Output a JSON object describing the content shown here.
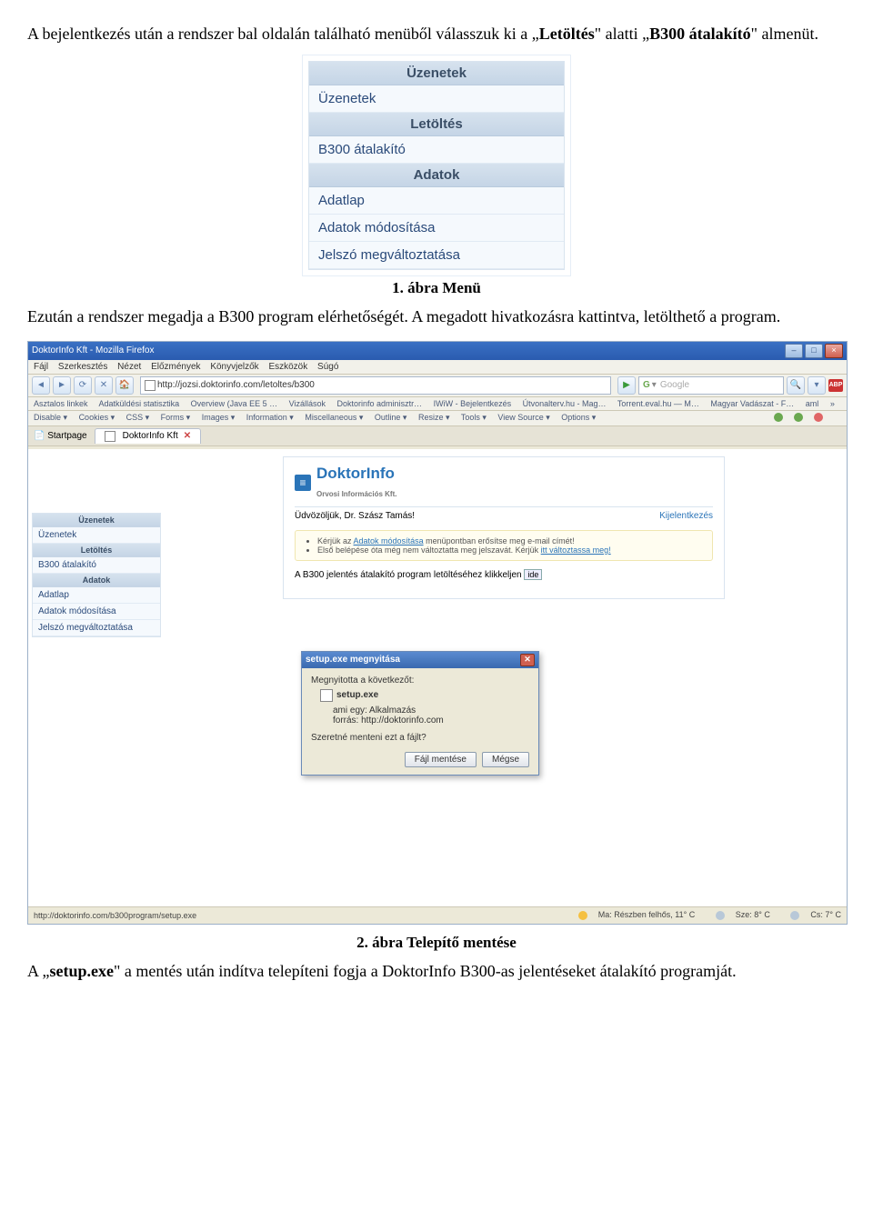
{
  "para1_a": "A bejelentkezés után a rendszer bal oldalán található menüből válasszuk ki a „",
  "para1_b": "Letöltés",
  "para1_c": "\" alatti „",
  "para1_d": "B300 átalakító",
  "para1_e": "\" almenüt.",
  "menu": {
    "h1": "Üzenetek",
    "i1": "Üzenetek",
    "h2": "Letöltés",
    "i2": "B300 átalakító",
    "h3": "Adatok",
    "i3": "Adatlap",
    "i4": "Adatok módosítása",
    "i5": "Jelszó megváltoztatása"
  },
  "caption1": "1. ábra Menü",
  "para2": "Ezután a rendszer megadja a B300 program elérhetőségét. A megadott hivatkozásra kattintva, letölthető a program.",
  "browser": {
    "title": "DoktorInfo Kft - Mozilla Firefox",
    "min": "‒",
    "max": "□",
    "close": "×",
    "ffmenu": {
      "m1": "Fájl",
      "m2": "Szerkesztés",
      "m3": "Nézet",
      "m4": "Előzmények",
      "m5": "Könyvjelzők",
      "m6": "Eszközök",
      "m7": "Súgó"
    },
    "nav": {
      "back": "◄",
      "fwd": "►",
      "reload": "⟳",
      "stop": "✕",
      "home": "🏠",
      "url": "http://jozsi.doktorinfo.com/letoltes/b300",
      "go": "▶",
      "search_placeholder": "Google",
      "search_icon": "G",
      "mag": "🔍",
      "down": "▾",
      "abp": "ABP"
    },
    "bookmarks": {
      "b1": "Asztalos linkek",
      "b2": "Adatküldési statisztika",
      "b3": "Overview (Java EE 5 …",
      "b4": "Vizállások",
      "b5": "Doktorinfo adminisztr…",
      "b6": "IWiW - Bejelentkezés",
      "b7": "Útvonalterv.hu - Mag…",
      "b8": "Torrent.eval.hu — M…",
      "b9": "Magyar Vadászat - F…",
      "b10": "aml",
      "more": "»"
    },
    "devbar": {
      "d1": "Disable ▾",
      "d2": "Cookies ▾",
      "d3": "CSS ▾",
      "d4": "Forms ▾",
      "d5": "Images ▾",
      "d6": "Information ▾",
      "d7": "Miscellaneous ▾",
      "d8": "Outline ▾",
      "d9": "Resize ▾",
      "d10": "Tools ▾",
      "d11": "View Source ▾",
      "d12": "Options ▾"
    },
    "tabs": {
      "startpage": "Startpage",
      "tab1": "DoktorInfo Kft",
      "close": "✕"
    },
    "sidebar": {
      "h1": "Üzenetek",
      "i1": "Üzenetek",
      "h2": "Letöltés",
      "i2": "B300 átalakító",
      "h3": "Adatok",
      "i3": "Adatlap",
      "i4": "Adatok módosítása",
      "i5": "Jelszó megváltoztatása"
    },
    "doc": {
      "logo_icon": "≡",
      "logo": "DoktorInfo",
      "logo_sub": "Orvosi Információs Kft.",
      "greeting": "Üdvözöljük, Dr. Szász Tamás!",
      "logout": "Kijelentkezés",
      "notice1a": "Kérjük az ",
      "notice1b": "Adatok módosítása",
      "notice1c": " menüpontban erősítse meg e-mail címét!",
      "notice2a": "Első belépése óta még nem változtatta meg jelszavát. Kérjük ",
      "notice2b": "itt változtassa meg!",
      "line_a": "A B300 jelentés átalakító program letöltéséhez klikkeljen ",
      "line_b": "ide"
    },
    "dialog": {
      "title": "setup.exe megnyitása",
      "close": "✕",
      "l1": "Megnyitotta a következőt:",
      "file": "setup.exe",
      "l2": "ami egy: Alkalmazás",
      "l3": "forrás: http://doktorinfo.com",
      "q": "Szeretné menteni ezt a fájlt?",
      "b_save": "Fájl mentése",
      "b_cancel": "Mégse"
    },
    "status": {
      "left": "http://doktorinfo.com/b300program/setup.exe",
      "w1": "Ma: Részben felhős, 11° C",
      "w2": "Sze: 8° C",
      "w3": "Cs: 7° C"
    }
  },
  "caption2": "2. ábra Telepítő mentése",
  "para3_a": "A „",
  "para3_b": "setup.exe",
  "para3_c": "\" a mentés után indítva telepíteni fogja a DoktorInfo B300-as jelentéseket átalakító programját."
}
